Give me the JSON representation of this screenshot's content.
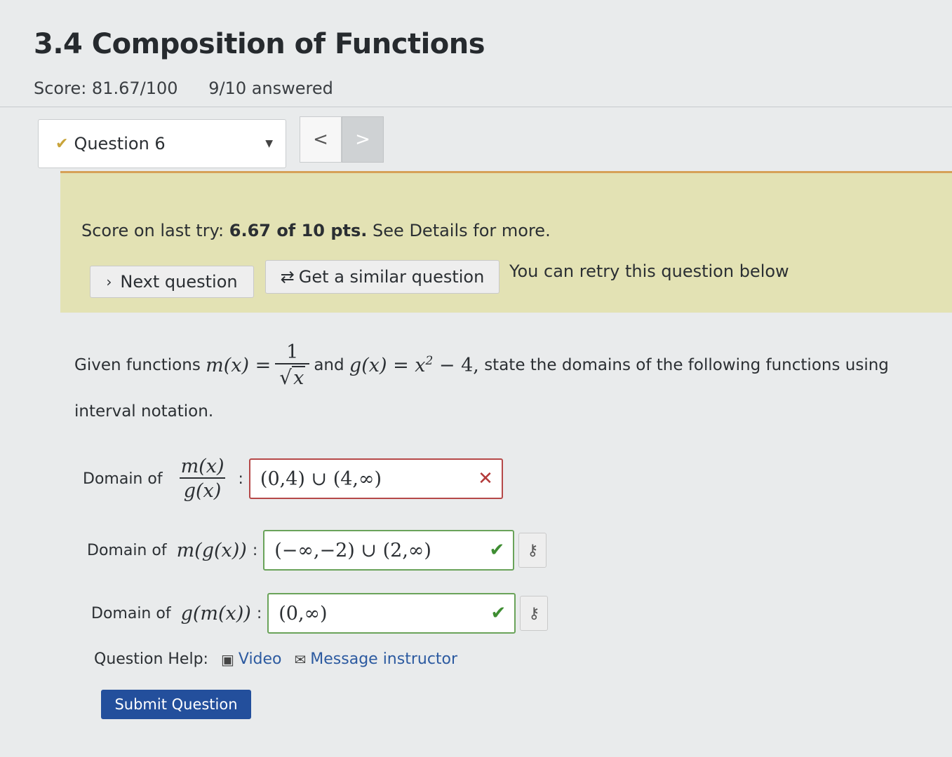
{
  "header": {
    "title": "3.4 Composition of Functions",
    "score": "Score: 81.67/100",
    "answered": "9/10 answered"
  },
  "question_nav": {
    "selected": "Question 6",
    "prev_symbol": "<",
    "next_symbol": ">"
  },
  "result": {
    "prefix": "Score on last try: ",
    "score_bold": "6.67 of 10 pts.",
    "suffix": " See Details for more.",
    "next_button": "Next question",
    "similar_button": "Get a similar question",
    "retry_note": "You can retry this question below"
  },
  "question": {
    "intro": "Given functions",
    "m_lhs": "m(x) =",
    "m_num": "1",
    "m_den": "x",
    "conj": "and",
    "g_def": "g(x) = x",
    "g_exp": "2",
    "g_tail": " − 4,",
    "rest": "state the domains of the following functions using",
    "line2": "interval notation."
  },
  "answers": [
    {
      "label": "Domain of",
      "expr_num": "m(x)",
      "expr_den": "g(x)",
      "value": "(0,4) ∪ (4,∞)",
      "status": "incorrect"
    },
    {
      "label": "Domain of",
      "expr": "m(g(x))",
      "value": "(−∞,−2) ∪ (2,∞)",
      "status": "correct"
    },
    {
      "label": "Domain of",
      "expr": "g(m(x))",
      "value": "(0,∞)",
      "status": "correct"
    }
  ],
  "help": {
    "label": "Question Help:",
    "video": "Video",
    "message": "Message instructor"
  },
  "submit_label": "Submit Question"
}
